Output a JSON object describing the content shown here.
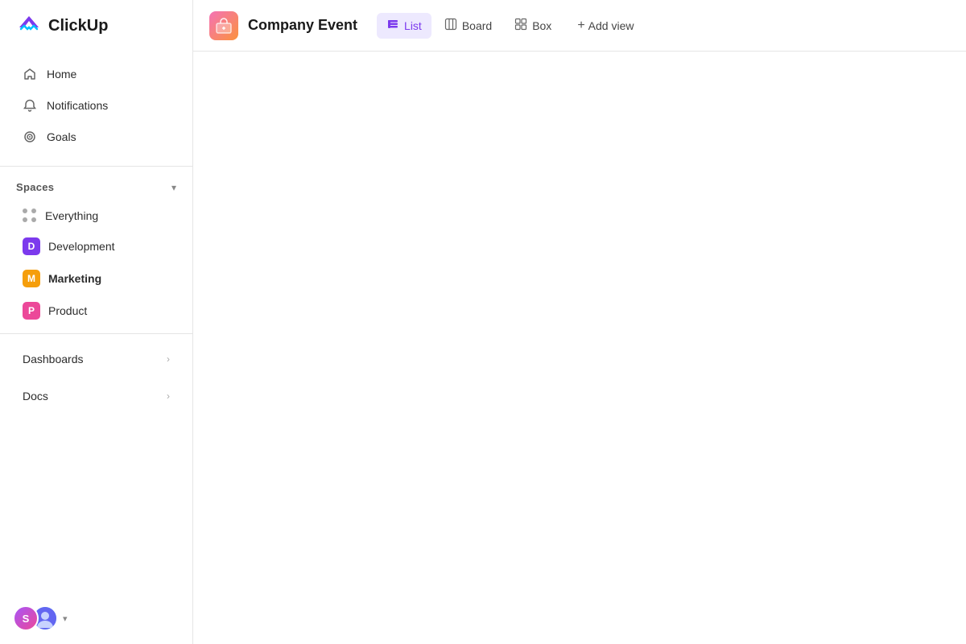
{
  "app": {
    "name": "ClickUp"
  },
  "sidebar": {
    "nav_items": [
      {
        "id": "home",
        "label": "Home",
        "icon": "home"
      },
      {
        "id": "notifications",
        "label": "Notifications",
        "icon": "bell"
      },
      {
        "id": "goals",
        "label": "Goals",
        "icon": "target"
      }
    ],
    "spaces_label": "Spaces",
    "spaces": [
      {
        "id": "everything",
        "label": "Everything",
        "type": "everything"
      },
      {
        "id": "development",
        "label": "Development",
        "type": "avatar",
        "color": "#7c3aed",
        "letter": "D"
      },
      {
        "id": "marketing",
        "label": "Marketing",
        "type": "avatar",
        "color": "#f59e0b",
        "letter": "M",
        "bold": true
      },
      {
        "id": "product",
        "label": "Product",
        "type": "avatar",
        "color": "#ec4899",
        "letter": "P"
      }
    ],
    "sections": [
      {
        "id": "dashboards",
        "label": "Dashboards"
      },
      {
        "id": "docs",
        "label": "Docs"
      }
    ],
    "bottom": {
      "user_initial": "S",
      "user_color": "#7c3aed"
    }
  },
  "topbar": {
    "project_title": "Company Event",
    "views": [
      {
        "id": "list",
        "label": "List",
        "icon": "list",
        "active": true
      },
      {
        "id": "board",
        "label": "Board",
        "icon": "board",
        "active": false
      },
      {
        "id": "box",
        "label": "Box",
        "icon": "box",
        "active": false
      }
    ],
    "add_view_label": "Add view"
  }
}
